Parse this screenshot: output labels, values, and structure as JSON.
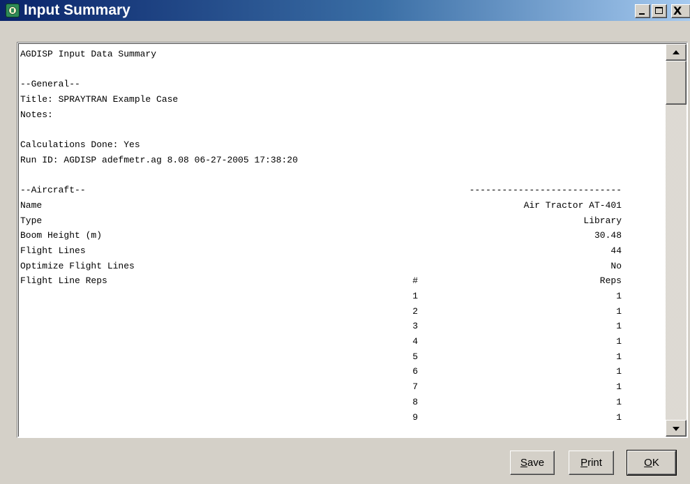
{
  "window": {
    "title": "Input Summary",
    "icon": "agdisp-app-icon",
    "controls": {
      "minimize_icon": "minimize-icon",
      "maximize_icon": "maximize-icon",
      "close_glyph": "X"
    }
  },
  "report": {
    "lines": [
      {
        "left": "AGDISP Input Data Summary"
      },
      {
        "left": ""
      },
      {
        "left": "--General--"
      },
      {
        "left": "Title: SPRAYTRAN Example Case"
      },
      {
        "left": "Notes:"
      },
      {
        "left": ""
      },
      {
        "left": "Calculations Done: Yes"
      },
      {
        "left": "Run ID: AGDISP adefmetr.ag 8.08 06-27-2005 17:38:20"
      },
      {
        "left": ""
      },
      {
        "left": "--Aircraft--",
        "right": "----------------------------"
      },
      {
        "left": "Name",
        "right": "Air Tractor AT-401"
      },
      {
        "left": "Type",
        "right": "Library"
      },
      {
        "left": "Boom Height (m)",
        "right": "30.48"
      },
      {
        "left": "Flight Lines",
        "right": "44"
      },
      {
        "left": "Optimize Flight Lines",
        "right": "No"
      },
      {
        "left": "Flight Line Reps",
        "num": "#",
        "right": "Reps"
      },
      {
        "num": "1",
        "right": "1"
      },
      {
        "num": "2",
        "right": "1"
      },
      {
        "num": "3",
        "right": "1"
      },
      {
        "num": "4",
        "right": "1"
      },
      {
        "num": "5",
        "right": "1"
      },
      {
        "num": "6",
        "right": "1"
      },
      {
        "num": "7",
        "right": "1"
      },
      {
        "num": "8",
        "right": "1"
      },
      {
        "num": "9",
        "right": "1"
      }
    ]
  },
  "buttons": {
    "save": {
      "mnemonic": "S",
      "rest": "ave"
    },
    "print": {
      "mnemonic": "P",
      "rest": "rint"
    },
    "ok": {
      "mnemonic": "O",
      "rest": "K"
    }
  },
  "colors": {
    "titlebar_start": "#0a246a",
    "titlebar_end": "#a6caf0",
    "face": "#d4d0c8"
  }
}
